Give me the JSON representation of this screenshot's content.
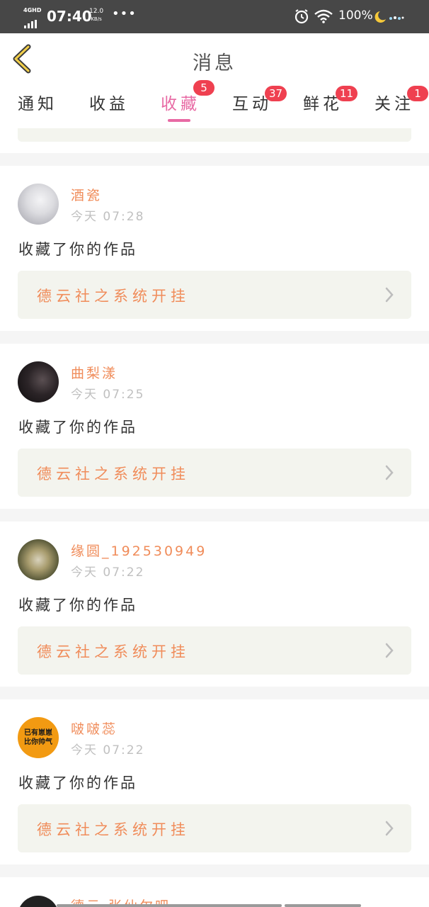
{
  "status_bar": {
    "network": "4GHD",
    "time": "07:40",
    "speed_value": "12.0",
    "speed_unit": "KB/s",
    "more": "•••",
    "battery": "100%",
    "icons": [
      "signal-icon",
      "alarm-icon",
      "wifi-icon",
      "moon-icon"
    ]
  },
  "header": {
    "title": "消息",
    "back_icon": "chevron-left-icon"
  },
  "tabs": [
    {
      "label": "通知",
      "badge": ""
    },
    {
      "label": "收益",
      "badge": ""
    },
    {
      "label": "收藏",
      "badge": "5",
      "active": true
    },
    {
      "label": "互动",
      "badge": "37"
    },
    {
      "label": "鲜花",
      "badge": "11"
    },
    {
      "label": "关注",
      "badge": "1"
    }
  ],
  "messages": [
    {
      "user": "酒瓷",
      "time": "今天 07:28",
      "action": "收藏了你的作品",
      "work": "德云社之系统开挂"
    },
    {
      "user": "曲梨漾",
      "time": "今天 07:25",
      "action": "收藏了你的作品",
      "work": "德云社之系统开挂"
    },
    {
      "user": "缘圆_192530949",
      "time": "今天 07:22",
      "action": "收藏了你的作品",
      "work": "德云社之系统开挂"
    },
    {
      "user": "啵啵蕊",
      "time": "今天 07:22",
      "action": "收藏了你的作品",
      "work": "德云社之系统开挂",
      "avatar_text": [
        "已有崽崽",
        "比你帅气"
      ]
    }
  ],
  "bottom_partial": {
    "user": "德云·张仙尔吧"
  },
  "colors": {
    "accent": "#e86aa4",
    "username": "#f08c5a",
    "badge": "#ef4050",
    "card_link_bg": "#f3f4ee",
    "status_bar": "#474747"
  }
}
